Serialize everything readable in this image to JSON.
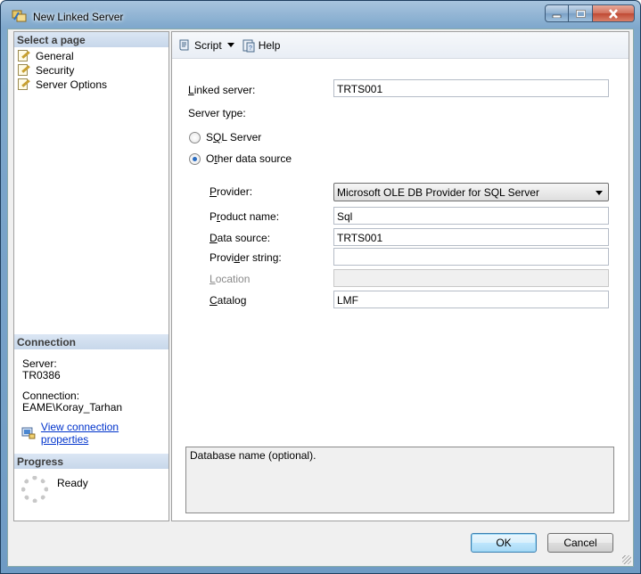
{
  "window": {
    "title": "New Linked Server"
  },
  "left": {
    "select_page_header": "Select a page",
    "pages": [
      "General",
      "Security",
      "Server Options"
    ],
    "connection_header": "Connection",
    "server_label": "Server:",
    "server_value": "TR0386",
    "connection_label": "Connection:",
    "connection_value": "EAME\\Koray_Tarhan",
    "view_connection_link": "View connection properties",
    "progress_header": "Progress",
    "progress_status": "Ready"
  },
  "toolbar": {
    "script_label": "Script",
    "help_label": "Help"
  },
  "form": {
    "linked_server_label": "Linked server:",
    "linked_server_value": "TRTS001",
    "server_type_label": "Server type:",
    "sql_server_label": "SQL Server",
    "other_source_label": "Other data source",
    "selected_server_type": "Other data source",
    "provider_label": "Provider:",
    "provider_value": "Microsoft OLE DB Provider for SQL Server",
    "product_name_label": "Product name:",
    "product_name_value": "Sql",
    "data_source_label": "Data source:",
    "data_source_value": "TRTS001",
    "provider_string_label": "Provider string:",
    "provider_string_value": "",
    "location_label": "Location",
    "location_value": "",
    "catalog_label": "Catalog",
    "catalog_value": "LMF"
  },
  "description": "Database name (optional).",
  "buttons": {
    "ok": "OK",
    "cancel": "Cancel"
  },
  "colors": {
    "accent": "#2a6cc0",
    "link": "#0033cc",
    "section_header": "#c7d7ea"
  }
}
